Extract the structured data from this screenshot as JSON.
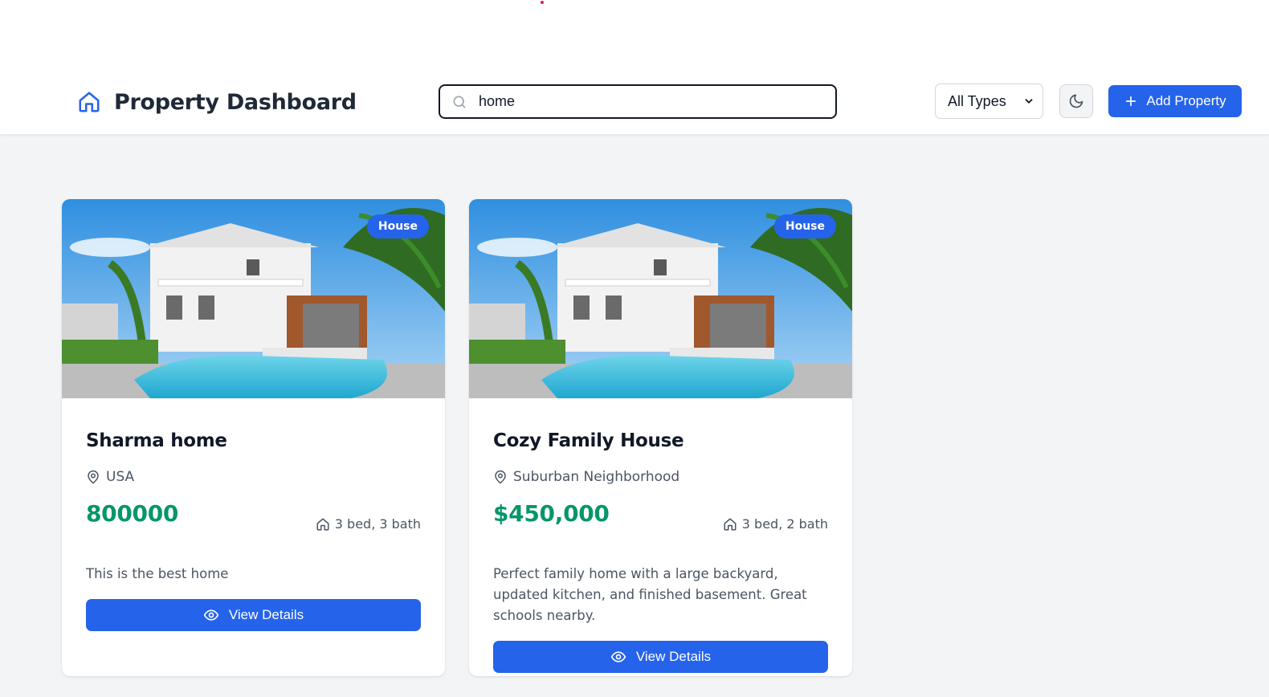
{
  "header": {
    "title": "Property Dashboard",
    "search": {
      "value": "home"
    },
    "type_filter": {
      "selected": "All Types"
    },
    "add_button_label": "Add Property"
  },
  "properties": [
    {
      "type_badge": "House",
      "title": "Sharma home",
      "location": "USA",
      "price": "800000",
      "specs": "3 bed, 3 bath",
      "description": "This is the best home",
      "view_button_label": "View Details"
    },
    {
      "type_badge": "House",
      "title": "Cozy Family House",
      "location": "Suburban Neighborhood",
      "price": "$450,000",
      "specs": "3 bed, 2 bath",
      "description": "Perfect family home with a large backyard, updated kitchen, and finished basement. Great schools nearby.",
      "view_button_label": "View Details"
    }
  ],
  "colors": {
    "primary": "#2563eb",
    "price": "#059669",
    "text": "#111827",
    "muted": "#4b5563",
    "background": "#f3f4f6"
  },
  "icons": [
    "home-icon",
    "search-icon",
    "chevron-down-icon",
    "moon-icon",
    "plus-icon",
    "map-pin-icon",
    "eye-icon"
  ]
}
